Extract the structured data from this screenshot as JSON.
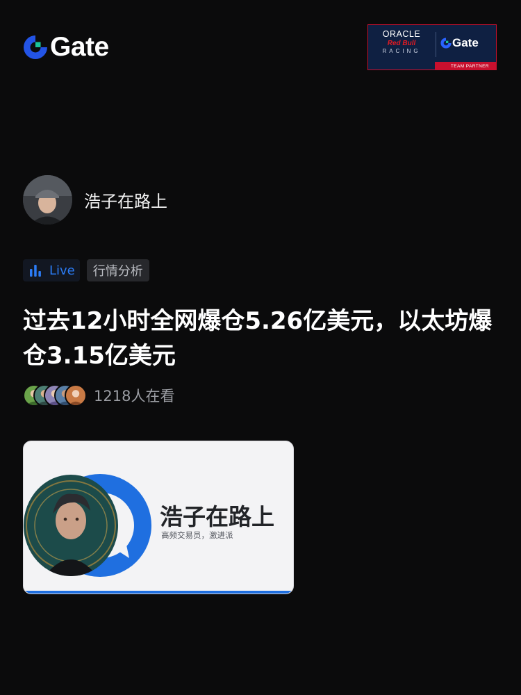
{
  "header": {
    "logo_icon": "gate-logo-icon",
    "logo_text": "Gate",
    "brand_color": "#2354e6",
    "partner": {
      "oracle": "ORACLE",
      "redbull": "Red Bull",
      "racing": "RACING",
      "gate": "Gate",
      "team_partner": "TEAM PARTNER"
    }
  },
  "author": {
    "name": "浩子在路上",
    "avatar_icon": "user-avatar"
  },
  "tags": {
    "live_icon": "bar-chart-icon",
    "live_label": "Live",
    "live_color": "#2b7cf6",
    "category": "行情分析"
  },
  "post": {
    "title": "过去12小时全网爆仓5.26亿美元，以太坊爆仓3.15亿美元"
  },
  "viewers": {
    "count_text": "1218人在看"
  },
  "card": {
    "name": "浩子在路上",
    "subtitle": "高频交易员，激进派",
    "icon": "chat-bubble-icon",
    "accent": "#1f6fe0"
  }
}
